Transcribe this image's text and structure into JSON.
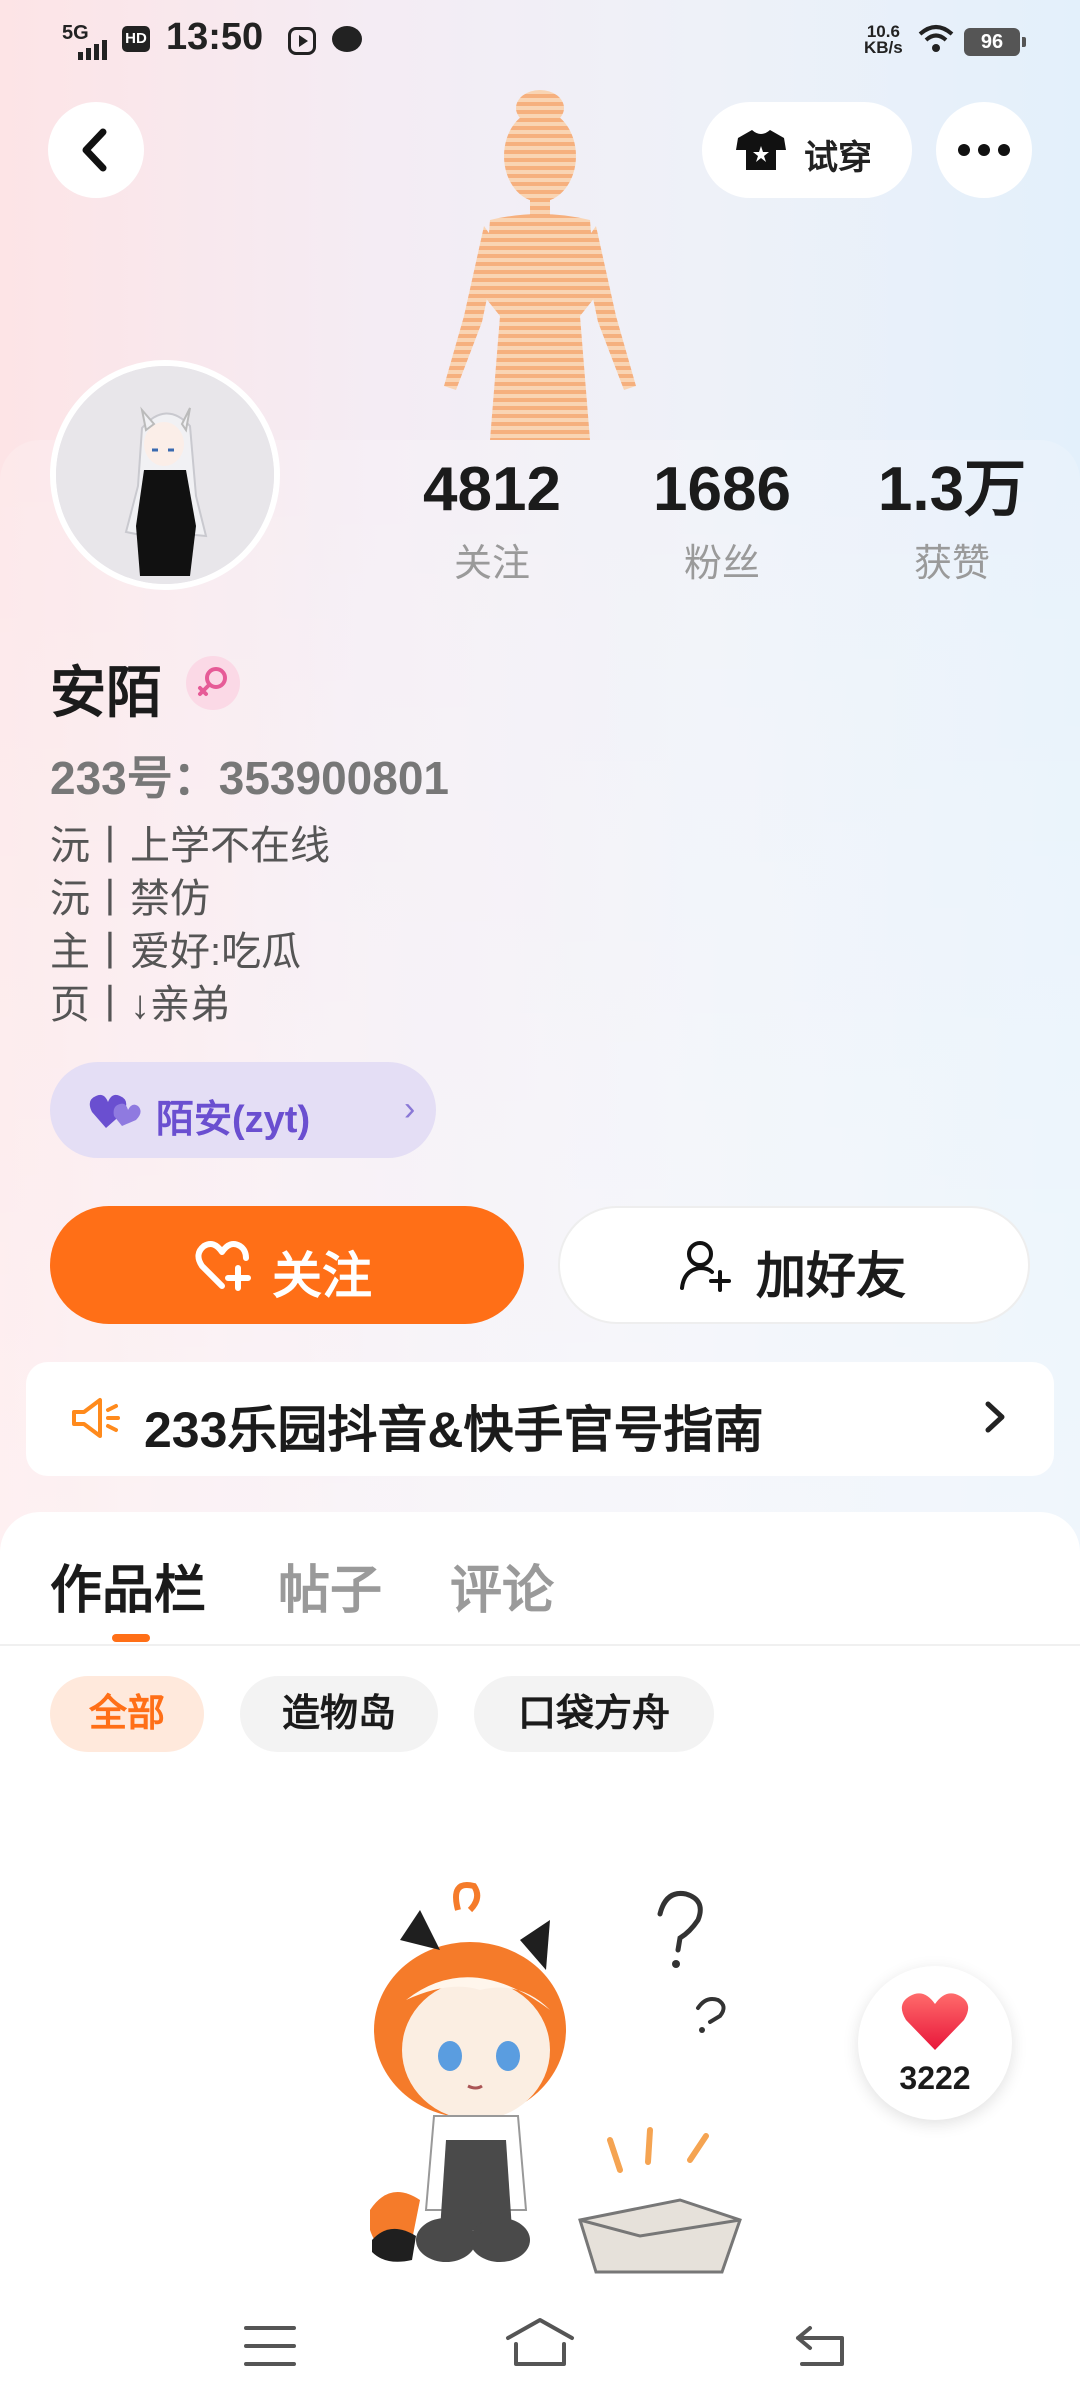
{
  "status_bar": {
    "network": "5G",
    "hd": "HD",
    "time": "13:50",
    "speed_value": "10.6",
    "speed_unit": "KB/s",
    "battery": "96"
  },
  "header": {
    "try_on_label": "试穿"
  },
  "stats": [
    {
      "value": "4812",
      "label": "关注"
    },
    {
      "value": "1686",
      "label": "粉丝"
    },
    {
      "value": "1.3万",
      "label": "获赞"
    }
  ],
  "profile": {
    "name": "安陌",
    "uid": "233号：353900801",
    "bio": [
      "沅丨上学不在线",
      "沅丨禁仿",
      "主丨爱好:吃瓜",
      "页丨↓亲弟"
    ],
    "guild_name": "陌安(zyt)",
    "guild_chevron": "›"
  },
  "actions": {
    "follow_label": "关注",
    "add_friend_label": "加好友"
  },
  "notice": {
    "text": "233乐园抖音&快手官号指南"
  },
  "tabs": [
    {
      "label": "作品栏",
      "active": true
    },
    {
      "label": "帖子",
      "active": false
    },
    {
      "label": "评论",
      "active": false
    }
  ],
  "filters": [
    {
      "label": "全部",
      "active": true
    },
    {
      "label": "造物岛",
      "active": false
    },
    {
      "label": "口袋方舟",
      "active": false
    }
  ],
  "likes": {
    "count": "3222"
  },
  "colors": {
    "accent": "#ff6f17",
    "guild": "#6a4fd0",
    "gender": "#e65b97"
  }
}
